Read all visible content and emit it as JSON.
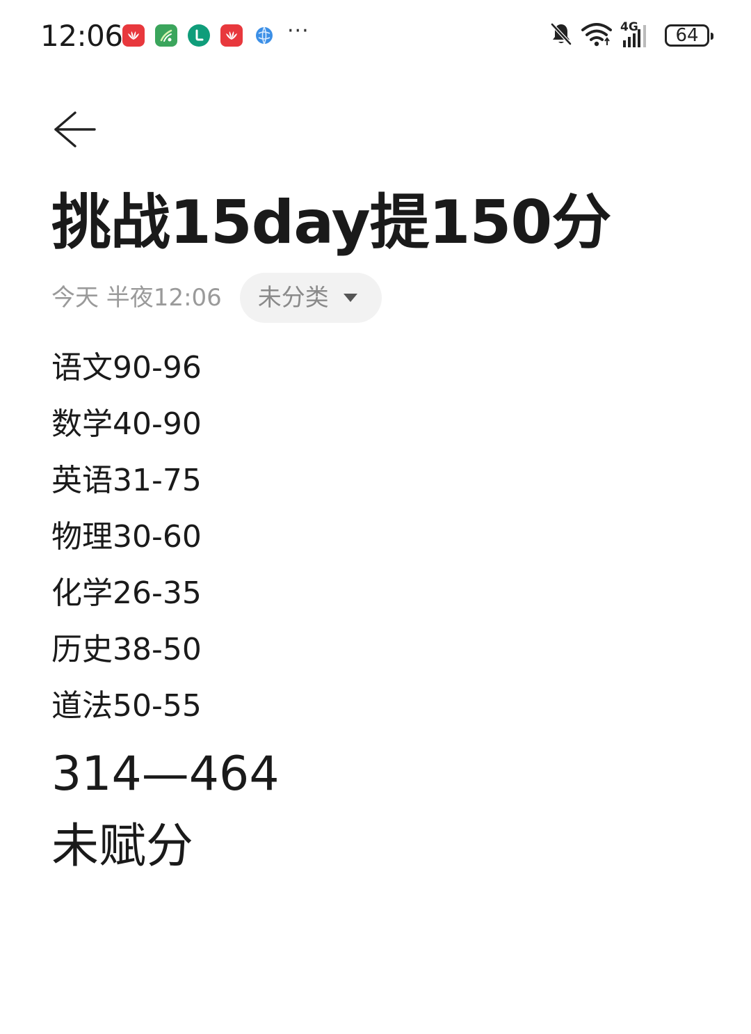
{
  "status_bar": {
    "time": "12:06",
    "battery_level": "64",
    "network_label": "4G",
    "notification_icons": [
      "huawei-app-icon",
      "ai-app-icon",
      "teal-app-icon",
      "huawei-app-icon",
      "globe-icon"
    ],
    "more_indicator": "···"
  },
  "note": {
    "title": "挑战15day提150分",
    "date": "今天 半夜12:06",
    "category": "未分类",
    "lines": [
      "语文90-96",
      "数学40-90",
      "英语31-75",
      "物理30-60",
      "化学26-35",
      "历史38-50",
      "道法50-55"
    ],
    "total": "314—464",
    "extra": "未赋分"
  },
  "colors": {
    "text_primary": "#1a1a1a",
    "text_secondary": "#9a9a9a",
    "chip_background": "#f2f2f2",
    "huawei_red": "#e8383d"
  }
}
